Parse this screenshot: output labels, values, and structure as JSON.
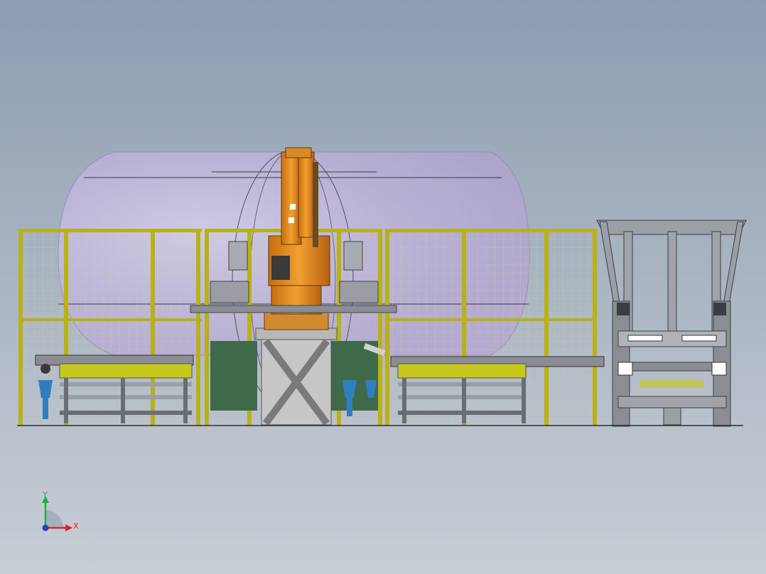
{
  "viewport": {
    "background_top": "#8c9db0",
    "background_bottom": "#c9ced6"
  },
  "model": {
    "colors": {
      "fence_frame": "#b8b214",
      "fence_mesh": "#d8d77a",
      "robot_orange": "#e08a1e",
      "robot_dark": "#5a3a10",
      "envelope_fill": "#b8a0d8",
      "steel": "#8a8e94",
      "steel_dark": "#4a4e55",
      "conveyor_yellow": "#c8c81a",
      "green_panel": "#3e6a4a",
      "blue_leg": "#2f7fc0",
      "base_grey": "#b7b7b7"
    }
  },
  "triad": {
    "x_label": "X",
    "y_label": "Y",
    "x_color": "#e02020",
    "y_color": "#20b040",
    "z_color": "#2040d0"
  }
}
